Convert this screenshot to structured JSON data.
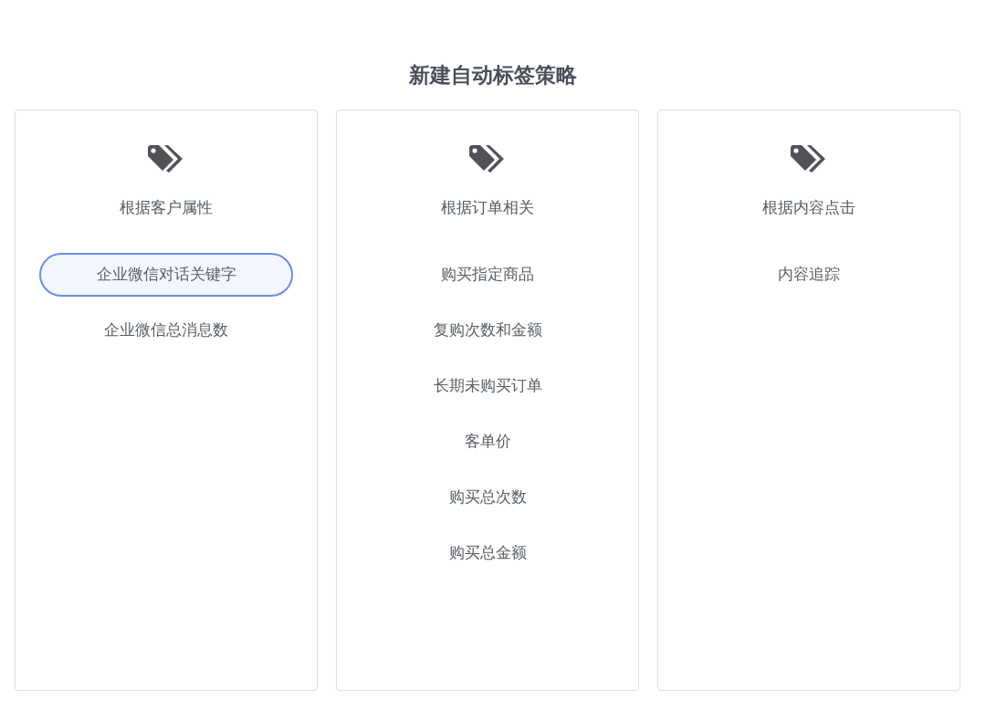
{
  "title": "新建自动标签策略",
  "categories": [
    {
      "label": "根据客户属性",
      "options": [
        {
          "label": "企业微信对话关键字",
          "selected": true
        },
        {
          "label": "企业微信总消息数",
          "selected": false
        }
      ]
    },
    {
      "label": "根据订单相关",
      "options": [
        {
          "label": "购买指定商品",
          "selected": false
        },
        {
          "label": "复购次数和金额",
          "selected": false
        },
        {
          "label": "长期未购买订单",
          "selected": false
        },
        {
          "label": "客单价",
          "selected": false
        },
        {
          "label": "购买总次数",
          "selected": false
        },
        {
          "label": "购买总金额",
          "selected": false
        }
      ]
    },
    {
      "label": "根据内容点击",
      "options": [
        {
          "label": "内容追踪",
          "selected": false
        }
      ]
    }
  ]
}
